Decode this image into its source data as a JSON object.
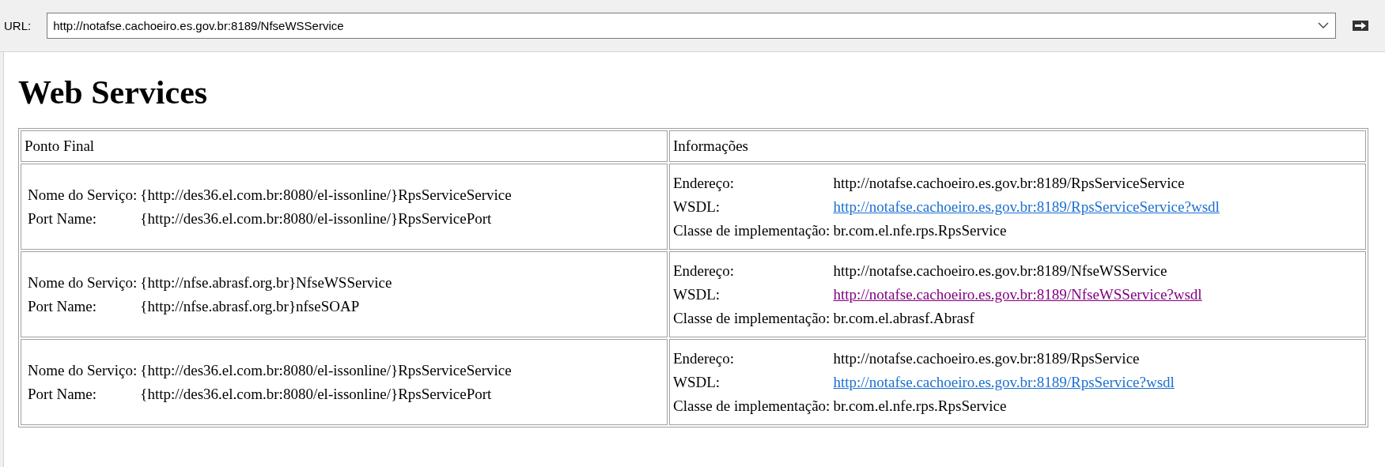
{
  "toolbar": {
    "url_label": "URL:",
    "url": "http://notafse.cachoeiro.es.gov.br:8189/NfseWSService"
  },
  "page": {
    "heading": "Web Services",
    "table": {
      "columns": [
        "Ponto Final",
        "Informações"
      ],
      "rows": [
        {
          "service_label": "Nome do Serviço:",
          "service": "{http://des36.el.com.br:8080/el-issonline/}RpsServiceService",
          "port_label": "Port Name:",
          "port": "{http://des36.el.com.br:8080/el-issonline/}RpsServicePort",
          "address_label": "Endereço:",
          "address": "http://notafse.cachoeiro.es.gov.br:8189/RpsServiceService",
          "wsdl_label": "WSDL:",
          "wsdl": "http://notafse.cachoeiro.es.gov.br:8189/RpsServiceService?wsdl",
          "visited": false,
          "class_label": "Classe de implementação:",
          "class": "br.com.el.nfe.rps.RpsService"
        },
        {
          "service_label": "Nome do Serviço:",
          "service": "{http://nfse.abrasf.org.br}NfseWSService",
          "port_label": "Port Name:",
          "port": "{http://nfse.abrasf.org.br}nfseSOAP",
          "address_label": "Endereço:",
          "address": "http://notafse.cachoeiro.es.gov.br:8189/NfseWSService",
          "wsdl_label": "WSDL:",
          "wsdl": "http://notafse.cachoeiro.es.gov.br:8189/NfseWSService?wsdl",
          "visited": true,
          "class_label": "Classe de implementação:",
          "class": "br.com.el.abrasf.Abrasf"
        },
        {
          "service_label": "Nome do Serviço:",
          "service": "{http://des36.el.com.br:8080/el-issonline/}RpsServiceService",
          "port_label": "Port Name:",
          "port": "{http://des36.el.com.br:8080/el-issonline/}RpsServicePort",
          "address_label": "Endereço:",
          "address": "http://notafse.cachoeiro.es.gov.br:8189/RpsService",
          "wsdl_label": "WSDL:",
          "wsdl": "http://notafse.cachoeiro.es.gov.br:8189/RpsService?wsdl",
          "visited": false,
          "class_label": "Classe de implementação:",
          "class": "br.com.el.nfe.rps.RpsService"
        }
      ]
    }
  }
}
